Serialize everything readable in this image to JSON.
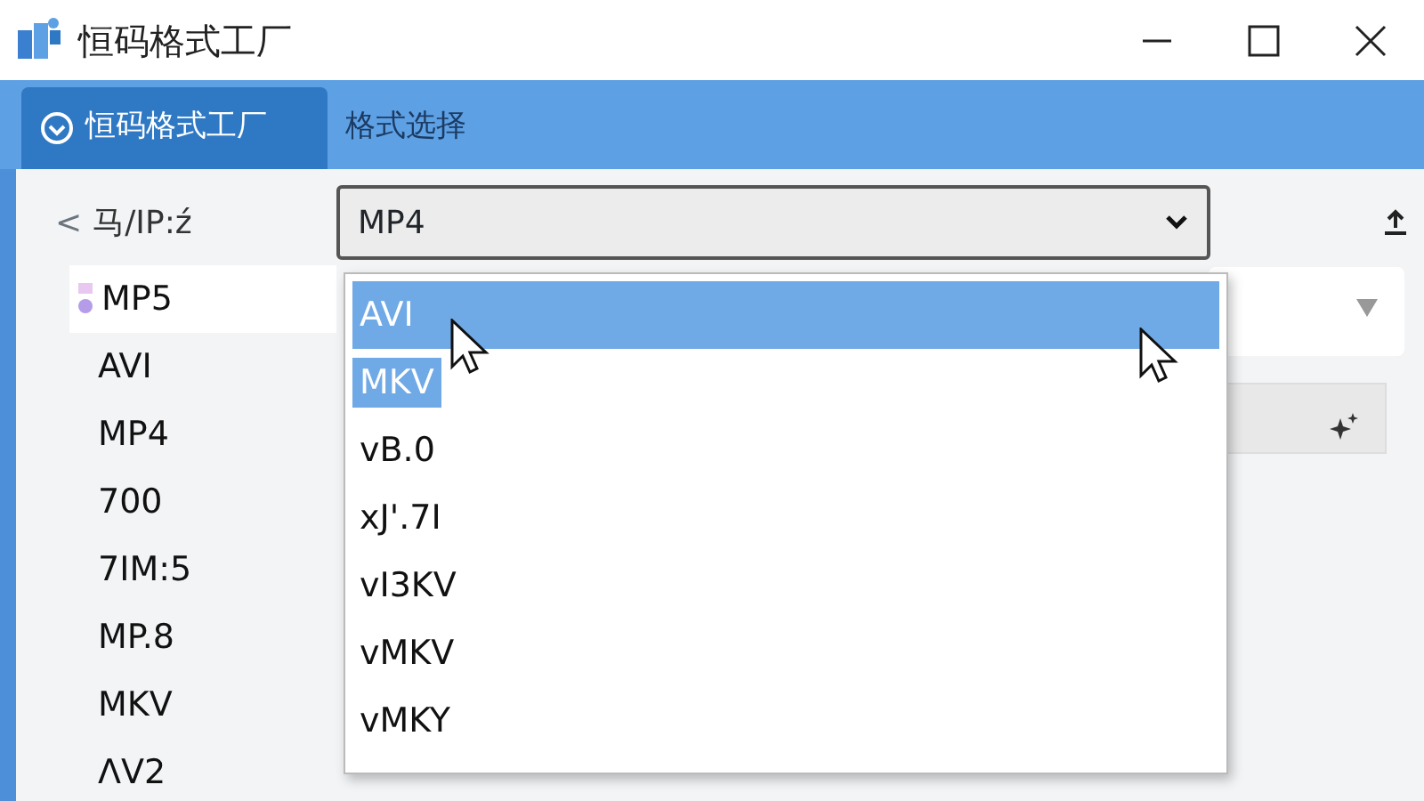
{
  "window": {
    "title": "恒码格式工厂"
  },
  "tabs": [
    {
      "label": "恒码格式工厂",
      "selected": true
    },
    {
      "label": "格式选择",
      "selected": false
    }
  ],
  "header": {
    "back": "<",
    "label": "马/IP:ź"
  },
  "format_select": {
    "value": "MP4"
  },
  "dropdown_options": [
    {
      "label": "AVI",
      "selected": true,
      "highlighted": true
    },
    {
      "label": "MKV",
      "selected": false,
      "highlighted": true
    },
    {
      "label": "vB.0",
      "selected": false,
      "highlighted": false
    },
    {
      "label": "xJ'.7I",
      "selected": false,
      "highlighted": false
    },
    {
      "label": "vI3KV",
      "selected": false,
      "highlighted": false
    },
    {
      "label": "vMKV",
      "selected": false,
      "highlighted": false
    },
    {
      "label": "vMKY",
      "selected": false,
      "highlighted": false
    }
  ],
  "format_list": [
    {
      "label": "MP5",
      "selected": true
    },
    {
      "label": "AVI",
      "selected": false
    },
    {
      "label": "MP4",
      "selected": false
    },
    {
      "label": "700",
      "selected": false
    },
    {
      "label": "7ΙΜ:5",
      "selected": false
    },
    {
      "label": "MP.8",
      "selected": false
    },
    {
      "label": "MKV",
      "selected": false
    },
    {
      "label": "ΛV2",
      "selected": false
    }
  ]
}
